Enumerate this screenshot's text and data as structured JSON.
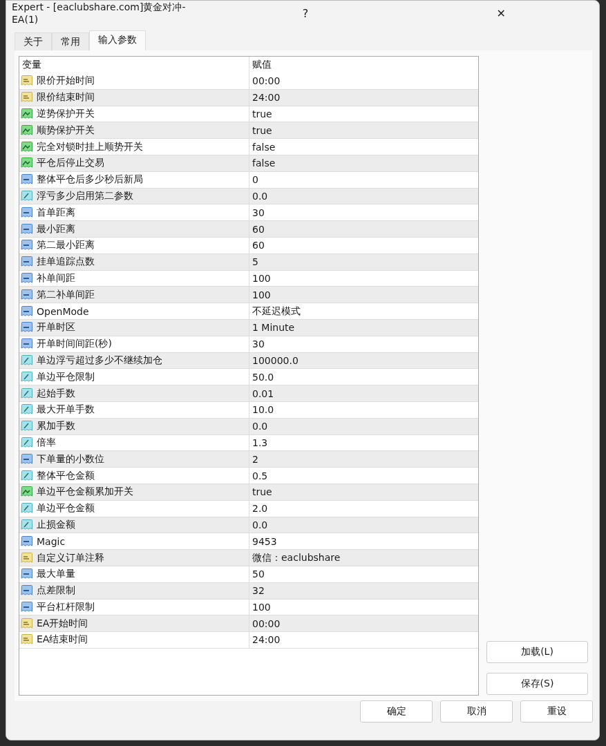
{
  "window": {
    "title": "Expert - [eaclubshare.com]黄金对冲-EA(1)",
    "help": "?",
    "close": "✕"
  },
  "tabs": [
    {
      "label": "关于",
      "selected": false
    },
    {
      "label": "常用",
      "selected": false
    },
    {
      "label": "输入参数",
      "selected": true
    }
  ],
  "table": {
    "columns": [
      "变量",
      "赋值"
    ],
    "rows": [
      {
        "kind": "text",
        "name": "限价开始时间",
        "value": "00:00"
      },
      {
        "kind": "text",
        "name": "限价结束时间",
        "value": "24:00"
      },
      {
        "kind": "bool",
        "name": "逆势保护开关",
        "value": "true"
      },
      {
        "kind": "bool",
        "name": "顺势保护开关",
        "value": "true"
      },
      {
        "kind": "bool",
        "name": "完全对锁时挂上顺势开关",
        "value": "false"
      },
      {
        "kind": "bool",
        "name": "平仓后停止交易",
        "value": "false"
      },
      {
        "kind": "int",
        "name": "整体平仓后多少秒后新局",
        "value": "0"
      },
      {
        "kind": "double",
        "name": "浮亏多少启用第二参数",
        "value": "0.0"
      },
      {
        "kind": "int",
        "name": "首单距离",
        "value": "30"
      },
      {
        "kind": "int",
        "name": "最小距离",
        "value": "60"
      },
      {
        "kind": "int",
        "name": "第二最小距离",
        "value": "60"
      },
      {
        "kind": "int",
        "name": "挂单追踪点数",
        "value": "5"
      },
      {
        "kind": "int",
        "name": "补单间距",
        "value": "100"
      },
      {
        "kind": "int",
        "name": "第二补单间距",
        "value": "100"
      },
      {
        "kind": "int",
        "name": "OpenMode",
        "value": "不延迟模式"
      },
      {
        "kind": "int",
        "name": "开单时区",
        "value": "1 Minute"
      },
      {
        "kind": "int",
        "name": "开单时间间距(秒)",
        "value": "30"
      },
      {
        "kind": "double",
        "name": "单边浮亏超过多少不继续加仓",
        "value": "100000.0"
      },
      {
        "kind": "double",
        "name": "单边平仓限制",
        "value": "50.0"
      },
      {
        "kind": "double",
        "name": "起始手数",
        "value": "0.01"
      },
      {
        "kind": "double",
        "name": "最大开单手数",
        "value": "10.0"
      },
      {
        "kind": "double",
        "name": "累加手数",
        "value": "0.0"
      },
      {
        "kind": "double",
        "name": "倍率",
        "value": "1.3"
      },
      {
        "kind": "int",
        "name": "下单量的小数位",
        "value": "2"
      },
      {
        "kind": "double",
        "name": "整体平仓金额",
        "value": "0.5"
      },
      {
        "kind": "bool",
        "name": "单边平仓金额累加开关",
        "value": "true"
      },
      {
        "kind": "double",
        "name": "单边平仓金额",
        "value": "2.0"
      },
      {
        "kind": "double",
        "name": "止损金额",
        "value": "0.0"
      },
      {
        "kind": "int",
        "name": "Magic",
        "value": "9453"
      },
      {
        "kind": "text",
        "name": "自定义订单注释",
        "value": "微信：eaclubshare"
      },
      {
        "kind": "int",
        "name": "最大单量",
        "value": "50"
      },
      {
        "kind": "int",
        "name": "点差限制",
        "value": "32"
      },
      {
        "kind": "int",
        "name": "平台杠杆限制",
        "value": "100"
      },
      {
        "kind": "text",
        "name": "EA开始时间",
        "value": "00:00"
      },
      {
        "kind": "text",
        "name": "EA结束时间",
        "value": "24:00"
      }
    ]
  },
  "side_buttons": [
    "加载(L)",
    "保存(S)"
  ],
  "bottom_buttons": [
    "确定",
    "取消",
    "重设"
  ]
}
